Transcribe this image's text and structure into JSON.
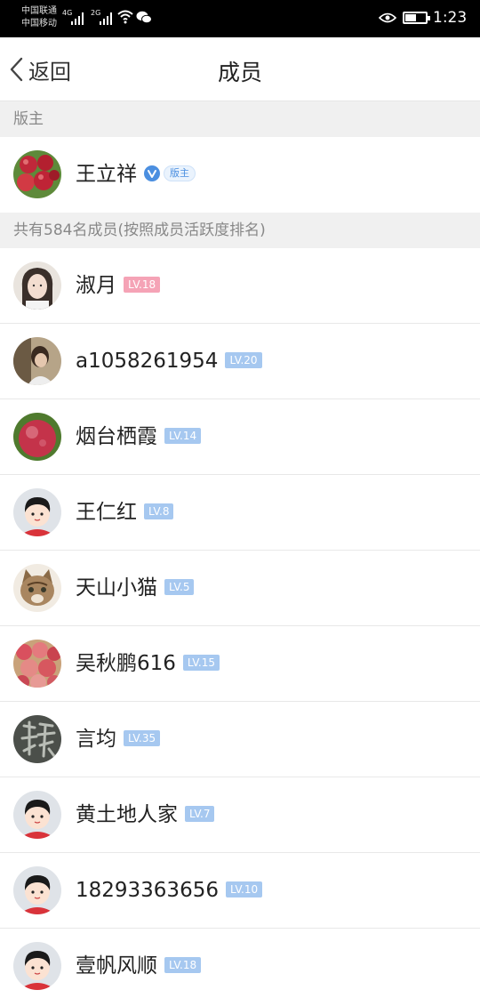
{
  "status_bar": {
    "carrier_1": "中国联通",
    "carrier_2": "中国移动",
    "signal_1_label": "4G",
    "signal_2_label": "2G",
    "time": "1:23",
    "battery_level": 0.5
  },
  "nav": {
    "back_label": "返回",
    "title": "成员"
  },
  "owner_section": {
    "header": "版主",
    "owner": {
      "name": "王立祥",
      "tag": "版主",
      "avatar": "red-apples"
    }
  },
  "member_section": {
    "header": "共有584名成员(按照成员活跃度排名)",
    "members": [
      {
        "name": "淑月",
        "level": "LV.18",
        "level_color": "#f5a3b6",
        "avatar": "portrait-woman"
      },
      {
        "name": "a1058261954",
        "level": "LV.20",
        "level_color": "#a6c8f0",
        "avatar": "portrait-dark"
      },
      {
        "name": "烟台栖霞",
        "level": "LV.14",
        "level_color": "#a6c8f0",
        "avatar": "red-apple"
      },
      {
        "name": "王仁红",
        "level": "LV.8",
        "level_color": "#a6c8f0",
        "avatar": "default-cartoon"
      },
      {
        "name": "天山小猫",
        "level": "LV.5",
        "level_color": "#a6c8f0",
        "avatar": "kitten"
      },
      {
        "name": "吴秋鹏616",
        "level": "LV.15",
        "level_color": "#a6c8f0",
        "avatar": "apple-pile"
      },
      {
        "name": "言均",
        "level": "LV.35",
        "level_color": "#a6c8f0",
        "avatar": "calligraphy"
      },
      {
        "name": "黄土地人家",
        "level": "LV.7",
        "level_color": "#a6c8f0",
        "avatar": "default-cartoon"
      },
      {
        "name": "18293363656",
        "level": "LV.10",
        "level_color": "#a6c8f0",
        "avatar": "default-cartoon"
      },
      {
        "name": "壹帆风顺",
        "level": "LV.18",
        "level_color": "#a6c8f0",
        "avatar": "default-cartoon"
      }
    ]
  },
  "colors": {
    "level_blue": "#a6c8f0",
    "level_pink": "#f5a3b6",
    "section_bg": "#f0f0f0",
    "verified_blue": "#4b8fe0"
  }
}
